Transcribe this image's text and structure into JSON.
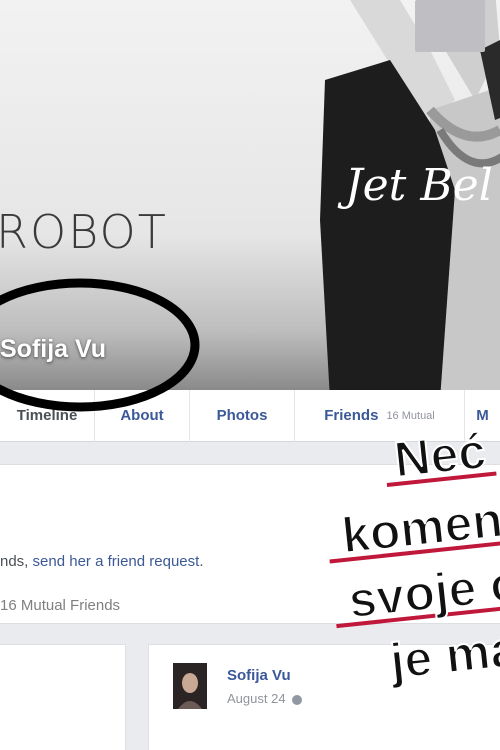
{
  "cover": {
    "text": "ROBOT",
    "shirt_text": "Jet Bel"
  },
  "profile": {
    "name": "Sofija Vu"
  },
  "nav": {
    "tabs": [
      {
        "label": "Timeline"
      },
      {
        "label": "About"
      },
      {
        "label": "Photos"
      },
      {
        "label": "Friends",
        "extra": "16 Mutual"
      },
      {
        "label": "M"
      }
    ]
  },
  "info": {
    "friend_prefix": "nds, ",
    "friend_link": "send her a friend request",
    "friend_suffix": ".",
    "mutual": "16 Mutual Friends"
  },
  "post": {
    "author": "Sofija Vu",
    "date": "August 24"
  },
  "headline": {
    "lines": [
      "Neć",
      "komen",
      "svoje o",
      "je ma"
    ]
  },
  "colors": {
    "link": "#3b5998",
    "headline_text": "#111111",
    "headline_underline": "#c0183b"
  }
}
